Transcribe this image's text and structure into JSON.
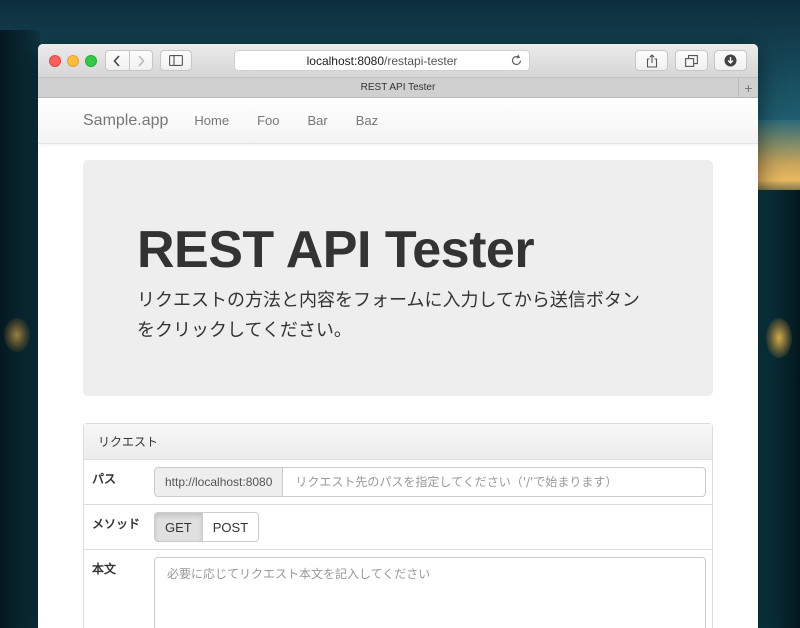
{
  "browser": {
    "address_host": "localhost:8080",
    "address_path": "/restapi-tester",
    "tab_title": "REST API Tester",
    "tab_add": "+"
  },
  "navbar": {
    "brand": "Sample.app",
    "links": [
      "Home",
      "Foo",
      "Bar",
      "Baz"
    ]
  },
  "jumbotron": {
    "title": "REST API Tester",
    "lead": "リクエストの方法と内容をフォームに入力してから送信ボタンをクリックしてください。"
  },
  "panel": {
    "heading": "リクエスト",
    "path_label": "パス",
    "path_prefix": "http://localhost:8080",
    "path_placeholder": "リクエスト先のパスを指定してください（'/'で始まります）",
    "method_label": "メソッド",
    "methods": [
      "GET",
      "POST"
    ],
    "selected_method": "GET",
    "body_label": "本文",
    "body_placeholder": "必要に応じてリクエスト本文を記入してください"
  },
  "colors": {
    "close": "#fc605c",
    "minimize": "#fdbc40",
    "maximize": "#34c84a",
    "jumbotron_bg": "#eeeeee"
  }
}
